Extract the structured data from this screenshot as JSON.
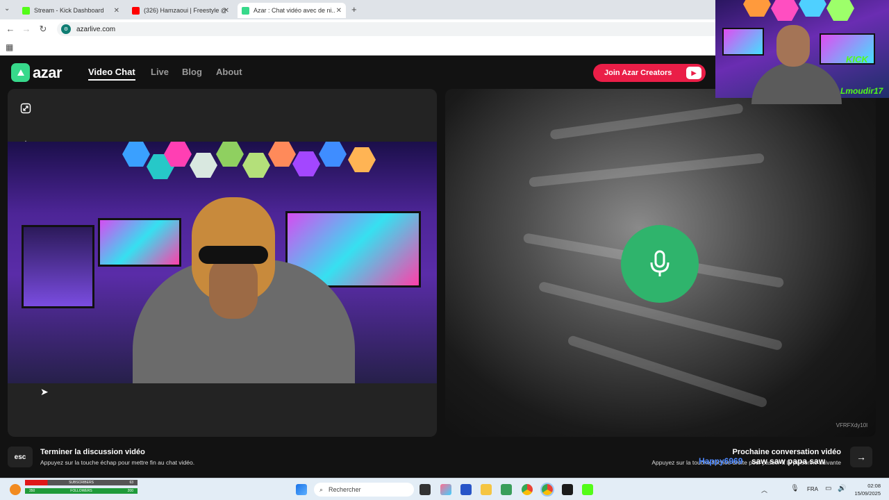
{
  "browser": {
    "tabs": [
      {
        "title": "Stream - Kick Dashboard",
        "color": "#53fc18"
      },
      {
        "title": "(326) Hamzaoui | Freestyle @R...",
        "color": "#ff0000"
      },
      {
        "title": "Azar : Chat vidéo avec de ni...",
        "color": "#37d98b"
      }
    ],
    "url": "azarlive.com"
  },
  "site": {
    "logo_text": "azar",
    "nav": [
      {
        "label": "Video Chat"
      },
      {
        "label": "Live"
      },
      {
        "label": "Blog"
      },
      {
        "label": "About"
      }
    ],
    "join_button": "Join Azar Creators"
  },
  "left_panel": {
    "buttons": [
      "expand-icon",
      "sparkle-icon",
      "face-icon"
    ]
  },
  "right_panel": {
    "video_id": "VFRFXdy10l"
  },
  "footer": {
    "esc_label": "esc",
    "end_title": "Terminer la discussion vidéo",
    "end_sub": "Appuyez sur la touche échap pour mettre fin au chat vidéo.",
    "next_title": "Prochaine conversation vidéo",
    "next_sub": "Appuyez sur la touche fléchée droite pour passer à la personne suivante",
    "overlay_name": "Happy6969",
    "overlay_msg": "saw saw papa saw"
  },
  "stream_overlay": {
    "kick_label": "KICK",
    "streamer_name": "Lmoudir17"
  },
  "taskbar": {
    "search_placeholder": "Rechercher",
    "language": "FRA",
    "time": "02:08",
    "date": "15/09/2025",
    "subscribers_label": "SUBSCRIBERS",
    "subscribers_value": "63",
    "followers_label": "FOLLOWERS",
    "followers_value": "200",
    "followers_min": "350"
  }
}
